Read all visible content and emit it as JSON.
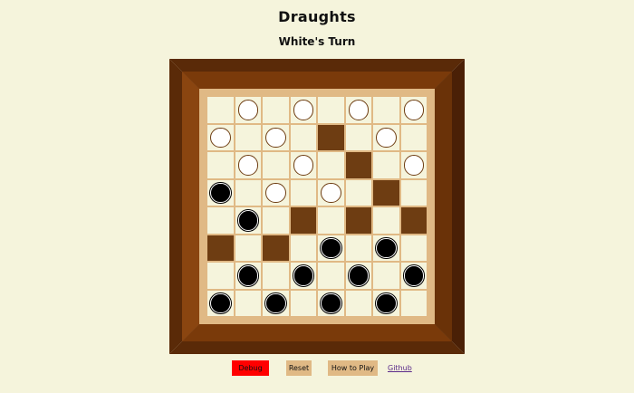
{
  "header": {
    "title": "Draughts",
    "turn_status": "White's Turn"
  },
  "board": {
    "rows": 8,
    "cols": 8,
    "colors": {
      "light_square": "#f5f4dc",
      "dark_square": "#6e3d12",
      "frame_outer": "#5a2a08",
      "frame_inner": "#e0b985",
      "white_piece": "#ffffff",
      "black_piece": "#000000"
    },
    "layout": [
      "LWLWLWLW",
      "WLWLDLWL",
      "LWLWLDLW",
      "BLWLWLDL",
      "LBLDLDLD",
      "DLDLBLBL",
      "LBLBLBLB",
      "BLBLBLBL"
    ]
  },
  "controls": {
    "debug_label": "Debug",
    "debug_color": "#ff0000",
    "reset_label": "Reset",
    "howto_label": "How to Play",
    "button_color": "#e0b985",
    "github_label": "Github"
  }
}
